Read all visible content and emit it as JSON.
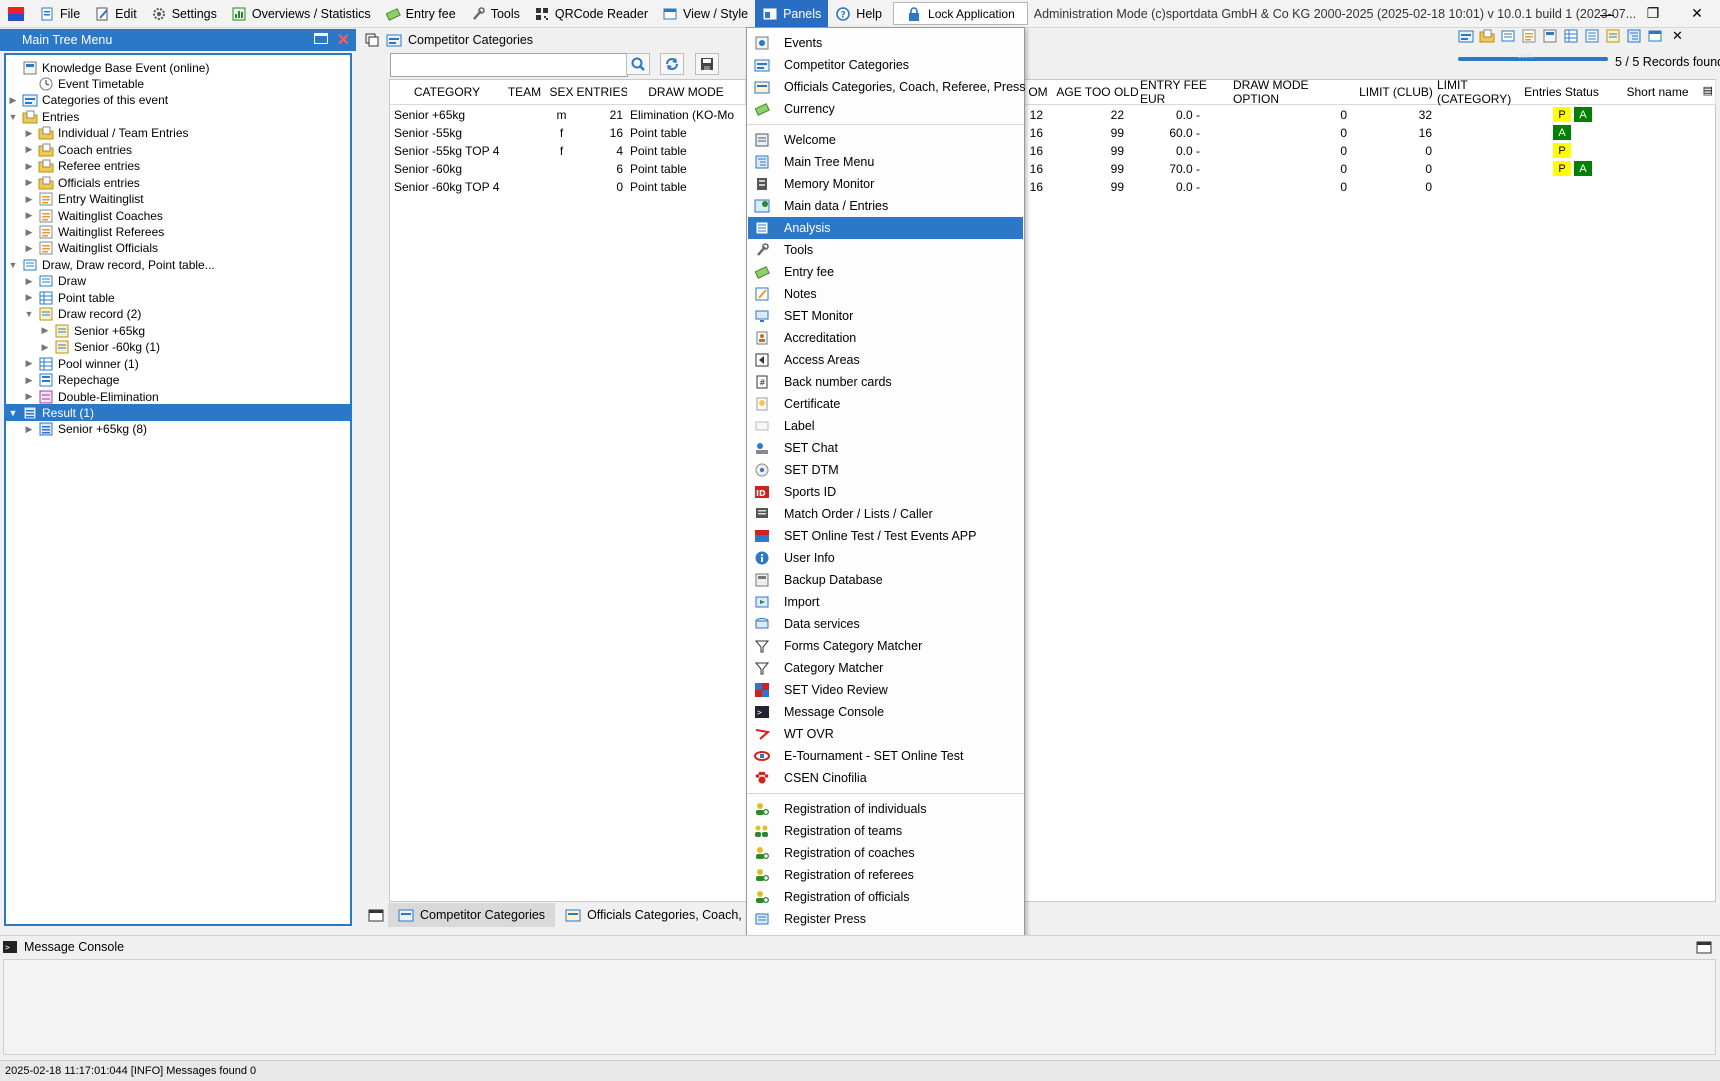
{
  "menubar": {
    "items": [
      {
        "label": "File",
        "icon": "file-icon"
      },
      {
        "label": "Edit",
        "icon": "edit-icon"
      },
      {
        "label": "Settings",
        "icon": "gear-icon"
      },
      {
        "label": "Overviews / Statistics",
        "icon": "overview-icon"
      },
      {
        "label": "Entry fee",
        "icon": "money-icon"
      },
      {
        "label": "Tools",
        "icon": "wrench-icon"
      },
      {
        "label": "QRCode Reader",
        "icon": "qrcode-icon"
      },
      {
        "label": "View / Style",
        "icon": "view-icon"
      },
      {
        "label": "Panels",
        "icon": "panels-icon"
      },
      {
        "label": "Help",
        "icon": "help-icon"
      }
    ],
    "lock_label": "Lock Application",
    "title": "Administration Mode (c)sportdata GmbH & Co KG 2000-2025 (2025-02-18 10:01)  v 10.0.1 build 1 (2023-07..."
  },
  "tree_panel": {
    "title": "Main Tree Menu",
    "nodes": [
      {
        "label": "Knowledge Base Event (online)",
        "level": 0,
        "expander": "",
        "icon": "event-icon"
      },
      {
        "label": "Event Timetable",
        "level": 1,
        "expander": "",
        "icon": "clock-icon"
      },
      {
        "label": "Categories of this event",
        "level": 0,
        "expander": "▶",
        "icon": "categories-icon"
      },
      {
        "label": "Entries",
        "level": 0,
        "expander": "▼",
        "icon": "folder-icon"
      },
      {
        "label": "Individual / Team Entries",
        "level": 1,
        "expander": "▶",
        "icon": "folder-icon"
      },
      {
        "label": "Coach entries",
        "level": 1,
        "expander": "▶",
        "icon": "folder-icon"
      },
      {
        "label": "Referee entries",
        "level": 1,
        "expander": "▶",
        "icon": "folder-icon"
      },
      {
        "label": "Officials entries",
        "level": 1,
        "expander": "▶",
        "icon": "folder-icon"
      },
      {
        "label": "Entry Waitinglist",
        "level": 1,
        "expander": "▶",
        "icon": "list-icon"
      },
      {
        "label": "Waitinglist Coaches",
        "level": 1,
        "expander": "▶",
        "icon": "list-icon"
      },
      {
        "label": "Waitinglist Referees",
        "level": 1,
        "expander": "▶",
        "icon": "list-icon"
      },
      {
        "label": "Waitinglist Officials",
        "level": 1,
        "expander": "▶",
        "icon": "list-icon"
      },
      {
        "label": "Draw, Draw record, Point table...",
        "level": 0,
        "expander": "▼",
        "icon": "draw-icon"
      },
      {
        "label": "Draw",
        "level": 1,
        "expander": "▶",
        "icon": "draw-icon"
      },
      {
        "label": "Point table",
        "level": 1,
        "expander": "▶",
        "icon": "table-icon"
      },
      {
        "label": "Draw record (2)",
        "level": 1,
        "expander": "▼",
        "icon": "draw-record-icon"
      },
      {
        "label": "Senior +65kg",
        "level": 2,
        "expander": "▶",
        "icon": "draw-record-icon"
      },
      {
        "label": "Senior -60kg (1)",
        "level": 2,
        "expander": "▶",
        "icon": "draw-record-icon"
      },
      {
        "label": "Pool winner (1)",
        "level": 1,
        "expander": "▶",
        "icon": "table-icon"
      },
      {
        "label": "Repechage",
        "level": 1,
        "expander": "▶",
        "icon": "repechage-icon"
      },
      {
        "label": "Double-Elimination",
        "level": 1,
        "expander": "▶",
        "icon": "double-elim-icon"
      },
      {
        "label": "Result (1)",
        "level": 0,
        "expander": "▼",
        "icon": "result-icon",
        "selected": true
      },
      {
        "label": "Senior +65kg (8)",
        "level": 1,
        "expander": "▶",
        "icon": "result-icon"
      }
    ]
  },
  "main": {
    "title": "Competitor Categories",
    "search_value": "",
    "records_found": "5 / 5 Records found",
    "progress_label": "100%",
    "columns": [
      "CATEGORY",
      "TEAM",
      "SEX",
      "ENTRIES",
      "DRAW MODE",
      "OM",
      "AGE TOO OLD",
      "ENTRY FEE EUR",
      "DRAW MODE OPTION",
      "LIMIT (CLUB)",
      "LIMIT (CATEGORY)",
      "Entries Status",
      "Short name"
    ],
    "rows": [
      {
        "category": "Senior +65kg",
        "team": "",
        "sex": "m",
        "entries": "21",
        "draw_mode": "Elimination (KO-Mo",
        "om": "12",
        "age_too_old": "22",
        "fee": "0.0 -",
        "limit_club": "0",
        "limit_cat": "32",
        "status": [
          "P",
          "A"
        ]
      },
      {
        "category": "Senior -55kg",
        "team": "",
        "sex": "f",
        "entries": "16",
        "draw_mode": "Point table",
        "om": "16",
        "age_too_old": "99",
        "fee": "60.0 -",
        "limit_club": "0",
        "limit_cat": "16",
        "status": [
          "A"
        ]
      },
      {
        "category": "Senior -55kg TOP 4",
        "team": "",
        "sex": "f",
        "entries": "4",
        "draw_mode": "Point table",
        "om": "16",
        "age_too_old": "99",
        "fee": "0.0 -",
        "limit_club": "0",
        "limit_cat": "0",
        "status": [
          "P"
        ]
      },
      {
        "category": "Senior -60kg",
        "team": "",
        "sex": "",
        "entries": "6",
        "draw_mode": "Point table",
        "om": "16",
        "age_too_old": "99",
        "fee": "70.0 -",
        "limit_club": "0",
        "limit_cat": "0",
        "status": [
          "P",
          "A"
        ]
      },
      {
        "category": "Senior -60kg TOP 4",
        "team": "",
        "sex": "",
        "entries": "0",
        "draw_mode": "Point table",
        "om": "16",
        "age_too_old": "99",
        "fee": "0.0 -",
        "limit_club": "0",
        "limit_cat": "0",
        "status": []
      }
    ],
    "bottom_tabs": [
      "Competitor Categories",
      "Officials Categories, Coach, Refere"
    ]
  },
  "panels_menu": {
    "groups": [
      [
        {
          "label": "Events",
          "icon": "events-icon"
        },
        {
          "label": "Competitor Categories",
          "icon": "categories-icon"
        },
        {
          "label": "Officials Categories, Coach, Referee, Press",
          "icon": "officials-categories-icon"
        },
        {
          "label": "Currency",
          "icon": "currency-icon"
        }
      ],
      [
        {
          "label": "Welcome",
          "icon": "welcome-icon"
        },
        {
          "label": "Main Tree Menu",
          "icon": "tree-menu-icon"
        },
        {
          "label": "Memory Monitor",
          "icon": "memory-icon"
        },
        {
          "label": "Main data / Entries",
          "icon": "main-data-icon"
        },
        {
          "label": "Analysis",
          "icon": "analysis-icon",
          "highlighted": true
        },
        {
          "label": "Tools",
          "icon": "wrench-icon"
        },
        {
          "label": "Entry fee",
          "icon": "money-icon"
        },
        {
          "label": "Notes",
          "icon": "notes-icon"
        },
        {
          "label": "SET Monitor",
          "icon": "monitor-icon"
        },
        {
          "label": "Accreditation",
          "icon": "accreditation-icon"
        },
        {
          "label": "Access Areas",
          "icon": "access-icon"
        },
        {
          "label": "Back number cards",
          "icon": "back-number-icon"
        },
        {
          "label": "Certificate",
          "icon": "certificate-icon"
        },
        {
          "label": "Label",
          "icon": "label-icon"
        },
        {
          "label": "SET Chat",
          "icon": "chat-icon"
        },
        {
          "label": "SET DTM",
          "icon": "dtm-icon"
        },
        {
          "label": "Sports ID",
          "icon": "sports-id-icon"
        },
        {
          "label": "Match Order / Lists / Caller",
          "icon": "match-order-icon"
        },
        {
          "label": "SET Online Test / Test Events APP",
          "icon": "online-test-icon"
        },
        {
          "label": "User Info",
          "icon": "info-icon"
        },
        {
          "label": "Backup Database",
          "icon": "backup-icon"
        },
        {
          "label": "Import",
          "icon": "import-icon"
        },
        {
          "label": "Data services",
          "icon": "data-services-icon"
        },
        {
          "label": "Forms Category Matcher",
          "icon": "matcher-icon"
        },
        {
          "label": "Category Matcher",
          "icon": "matcher-icon"
        },
        {
          "label": "SET Video Review",
          "icon": "video-review-icon"
        },
        {
          "label": "Message Console",
          "icon": "console-icon"
        },
        {
          "label": "WT OVR",
          "icon": "wt-ovr-icon"
        },
        {
          "label": "E-Tournament - SET Online Test",
          "icon": "etournament-icon"
        },
        {
          "label": "CSEN Cinofilia",
          "icon": "paw-icon"
        }
      ],
      [
        {
          "label": "Registration of individuals",
          "icon": "person-add-icon"
        },
        {
          "label": "Registration of teams",
          "icon": "team-add-icon"
        },
        {
          "label": "Registration of coaches",
          "icon": "person-add-icon"
        },
        {
          "label": "Registration of referees",
          "icon": "person-add-icon"
        },
        {
          "label": "Registration of officials",
          "icon": "person-add-icon"
        },
        {
          "label": "Register Press",
          "icon": "press-icon"
        }
      ]
    ]
  },
  "console": {
    "title": "Message Console"
  },
  "statusbar": {
    "text": "2025-02-18 11:17:01:044 [INFO] Messages found 0"
  },
  "colors": {
    "accent": "#2b78c9",
    "status_p": "#ffff00",
    "status_a": "#008000"
  }
}
